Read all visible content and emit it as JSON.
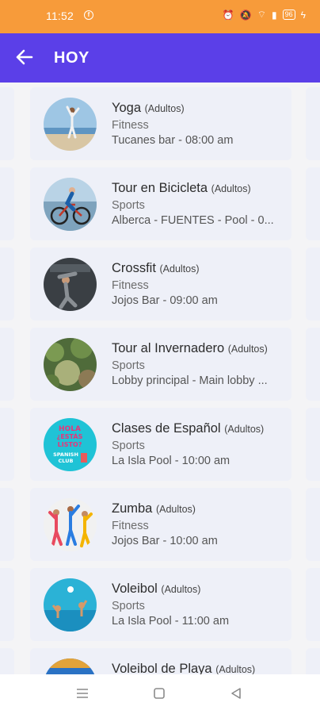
{
  "status": {
    "time": "11:52",
    "battery": "96"
  },
  "appbar": {
    "title": "HOY",
    "back_icon": "arrow-left-icon"
  },
  "activities": [
    {
      "name": "Yoga",
      "audience": "(Adultos)",
      "category": "Fitness",
      "location": "Tucanes bar - 08:00 am",
      "image": "yoga-photo"
    },
    {
      "name": "Tour en Bicicleta",
      "audience": "(Adultos)",
      "category": "Sports",
      "location": "Alberca - FUENTES - Pool - 0...",
      "image": "cyclist-photo"
    },
    {
      "name": "Crossfit",
      "audience": "(Adultos)",
      "category": "Fitness",
      "location": "Jojos Bar - 09:00 am",
      "image": "crossfit-photo"
    },
    {
      "name": "Tour al Invernadero",
      "audience": "(Adultos)",
      "category": "Sports",
      "location": "Lobby principal - Main lobby ...",
      "image": "greenhouse-photo"
    },
    {
      "name": "Clases de Español",
      "audience": "(Adultos)",
      "category": "Sports",
      "location": "La Isla Pool - 10:00 am",
      "image": "spanish-club-badge",
      "badge_text": [
        "HOLA",
        "¿ESTÁS",
        "LISTO?",
        "SPANISH",
        "CLUB"
      ]
    },
    {
      "name": "Zumba",
      "audience": "(Adultos)",
      "category": "Fitness",
      "location": "Jojos Bar - 10:00 am",
      "image": "zumba-photo"
    },
    {
      "name": "Voleibol",
      "audience": "(Adultos)",
      "category": "Sports",
      "location": "La Isla Pool - 11:00 am",
      "image": "pool-volleyball-photo"
    },
    {
      "name": "Voleibol de Playa",
      "audience": "(Adultos)",
      "category": "",
      "location": "",
      "image": "beach-volleyball-photo"
    }
  ],
  "navbar": {
    "menu": "menu-icon",
    "home": "home-square-icon",
    "back": "back-triangle-icon"
  }
}
